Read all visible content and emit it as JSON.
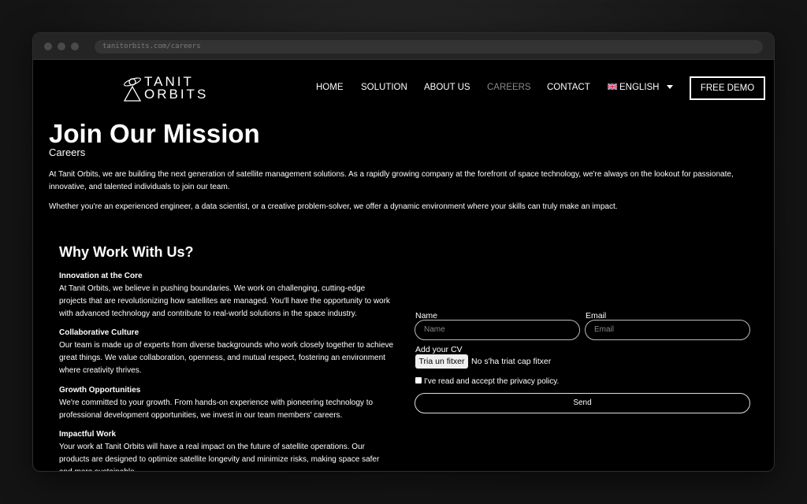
{
  "browser": {
    "url": "tanitorbits.com/careers"
  },
  "header": {
    "logo_line1": "TANIT",
    "logo_line2": "ORBITS",
    "nav": [
      "HOME",
      "SOLUTION",
      "ABOUT US",
      "CAREERS",
      "CONTACT"
    ],
    "language": "ENGLISH",
    "demo_label": "FREE DEMO"
  },
  "hero": {
    "title": "Join Our Mission",
    "subtitle": "Careers",
    "paragraph1": "At Tanit Orbits, we are building the next generation of satellite management solutions. As a rapidly growing company at the forefront of space technology, we're always on the lookout for passionate, innovative, and talented individuals to join our team.",
    "paragraph2": "Whether you're an experienced engineer, a data scientist, or a creative problem-solver, we offer a dynamic environment where your skills can truly make an impact."
  },
  "why": {
    "title": "Why Work With Us?",
    "sections": [
      {
        "heading": "Innovation at the Core",
        "text": "At Tanit Orbits, we believe in pushing boundaries. We work on challenging, cutting-edge projects that are revolutionizing how satellites are managed. You'll have the opportunity to work with advanced technology and contribute to real-world solutions in the space industry."
      },
      {
        "heading": "Collaborative Culture",
        "text": "Our team is made up of experts from diverse backgrounds who work closely together to achieve great things. We value collaboration, openness, and mutual respect, fostering an environment where creativity thrives."
      },
      {
        "heading": "Growth Opportunities",
        "text": "We're committed to your growth. From hands-on experience with pioneering technology to professional development opportunities, we invest in our team members' careers."
      },
      {
        "heading": "Impactful Work",
        "text": "Your work at Tanit Orbits will have a real impact on the future of satellite operations. Our products are designed to optimize satellite longevity and minimize risks, making space safer and more sustainable."
      }
    ]
  },
  "form": {
    "name_label": "Name",
    "name_placeholder": "Name",
    "email_label": "Email",
    "email_placeholder": "Email",
    "cv_label": "Add your CV",
    "file_button": "Tria un fitxer",
    "file_status": "No s'ha triat cap fitxer",
    "privacy_label": "I've read and accept the privacy policy.",
    "send_label": "Send"
  }
}
